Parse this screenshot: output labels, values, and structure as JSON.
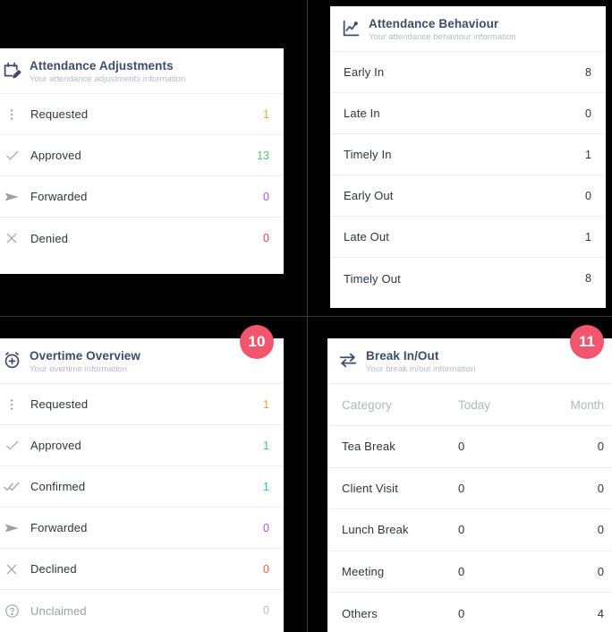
{
  "theme": {
    "accent": "#3b4d6b",
    "badge_bg": "#f2566f",
    "divider": "#eceef1",
    "card_bg": "#ffffff",
    "page_bg": "#000000",
    "muted": "#b4bbc6"
  },
  "cards": {
    "attendance_adjustments": {
      "icon": "calendar-edit-icon",
      "title": "Attendance Adjustments",
      "subtitle": "Your attendance adjustments information",
      "rows": [
        {
          "icon": "dots-vertical-icon",
          "label": "Requested",
          "value": "1",
          "color": "#f0a030"
        },
        {
          "icon": "check-icon",
          "label": "Approved",
          "value": "13",
          "color": "#4fc96a"
        },
        {
          "icon": "send-icon",
          "label": "Forwarded",
          "value": "0",
          "color": "#a855d0"
        },
        {
          "icon": "close-icon",
          "label": "Denied",
          "value": "0",
          "color": "#ef3d63"
        }
      ]
    },
    "attendance_behaviour": {
      "icon": "line-chart-icon",
      "title": "Attendance Behaviour",
      "subtitle": "Your attendance behaviour information",
      "rows": [
        {
          "label": "Early In",
          "value": "8"
        },
        {
          "label": "Late In",
          "value": "0"
        },
        {
          "label": "Timely In",
          "value": "1"
        },
        {
          "label": "Early Out",
          "value": "0"
        },
        {
          "label": "Late Out",
          "value": "1"
        },
        {
          "label": "Timely Out",
          "value": "8"
        }
      ]
    },
    "overtime_overview": {
      "icon": "alarm-plus-icon",
      "title": "Overtime Overview",
      "subtitle": "Your overtime information",
      "badge": "10",
      "rows": [
        {
          "icon": "dots-vertical-icon",
          "label": "Requested",
          "value": "1",
          "color": "#f0a030"
        },
        {
          "icon": "check-icon",
          "label": "Approved",
          "value": "1",
          "color": "#4fc96a"
        },
        {
          "icon": "double-check-icon",
          "label": "Confirmed",
          "value": "1",
          "color": "#29b6e8"
        },
        {
          "icon": "send-icon",
          "label": "Forwarded",
          "value": "0",
          "color": "#a855d0"
        },
        {
          "icon": "close-icon",
          "label": "Declined",
          "value": "0",
          "color": "#f4593c"
        },
        {
          "icon": "question-circle-icon",
          "label": "Unclaimed",
          "value": "0",
          "color": "#b6bcc5"
        }
      ]
    },
    "break_in_out": {
      "icon": "arrows-left-right-icon",
      "title": "Break In/Out",
      "subtitle": "Your break in/out information",
      "badge": "11",
      "columns": {
        "category": "Category",
        "today": "Today",
        "month": "Month"
      },
      "rows": [
        {
          "category": "Tea Break",
          "today": "0",
          "month": "0"
        },
        {
          "category": "Client Visit",
          "today": "0",
          "month": "0"
        },
        {
          "category": "Lunch Break",
          "today": "0",
          "month": "0"
        },
        {
          "category": "Meeting",
          "today": "0",
          "month": "0"
        },
        {
          "category": "Others",
          "today": "0",
          "month": "4"
        }
      ]
    }
  }
}
